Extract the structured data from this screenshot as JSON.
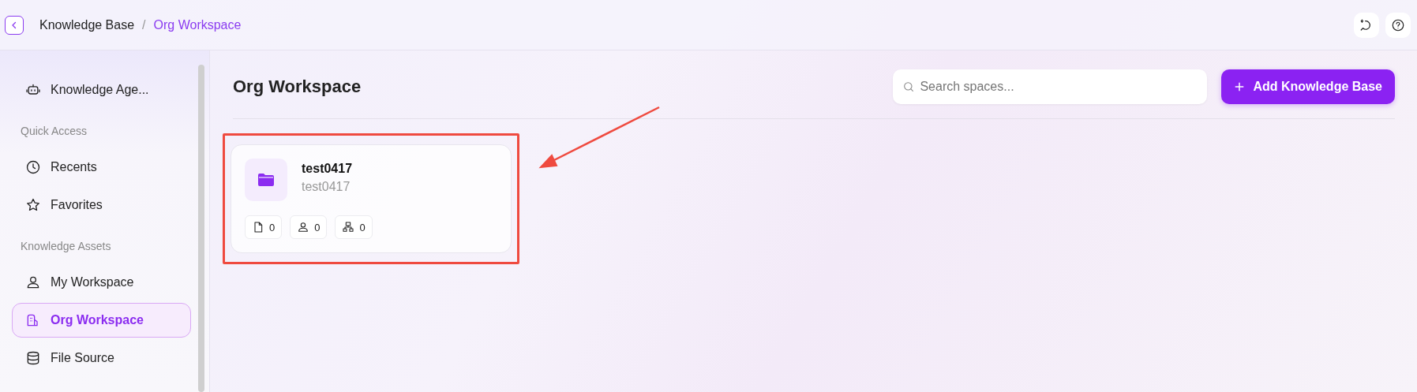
{
  "breadcrumb": [
    {
      "label": "Knowledge Base",
      "current": false
    },
    {
      "label": "/",
      "kind": "separator"
    },
    {
      "label": "Org Workspace",
      "current": true
    }
  ],
  "sidebar": {
    "items": [
      {
        "kind": "item",
        "label": "Knowledge Age...",
        "selected": false
      },
      {
        "kind": "heading",
        "label": "Quick Access"
      },
      {
        "kind": "item",
        "label": "Recents",
        "selected": false
      },
      {
        "kind": "item",
        "label": "Favorites",
        "selected": false
      },
      {
        "kind": "heading",
        "label": "Knowledge Assets"
      },
      {
        "kind": "item",
        "label": "My Workspace",
        "selected": false
      },
      {
        "kind": "item",
        "label": "Org Workspace",
        "selected": true
      },
      {
        "kind": "item",
        "label": "File Source",
        "selected": false
      }
    ]
  },
  "page": {
    "title": "Org Workspace",
    "search": {
      "placeholder": "Search spaces..."
    },
    "add_button": "Add Knowledge Base"
  },
  "cards": [
    {
      "name": "test0417",
      "description": "test0417",
      "highlighted": true,
      "stats": [
        {
          "count": "0"
        },
        {
          "count": "0"
        },
        {
          "count": "0"
        }
      ]
    }
  ]
}
